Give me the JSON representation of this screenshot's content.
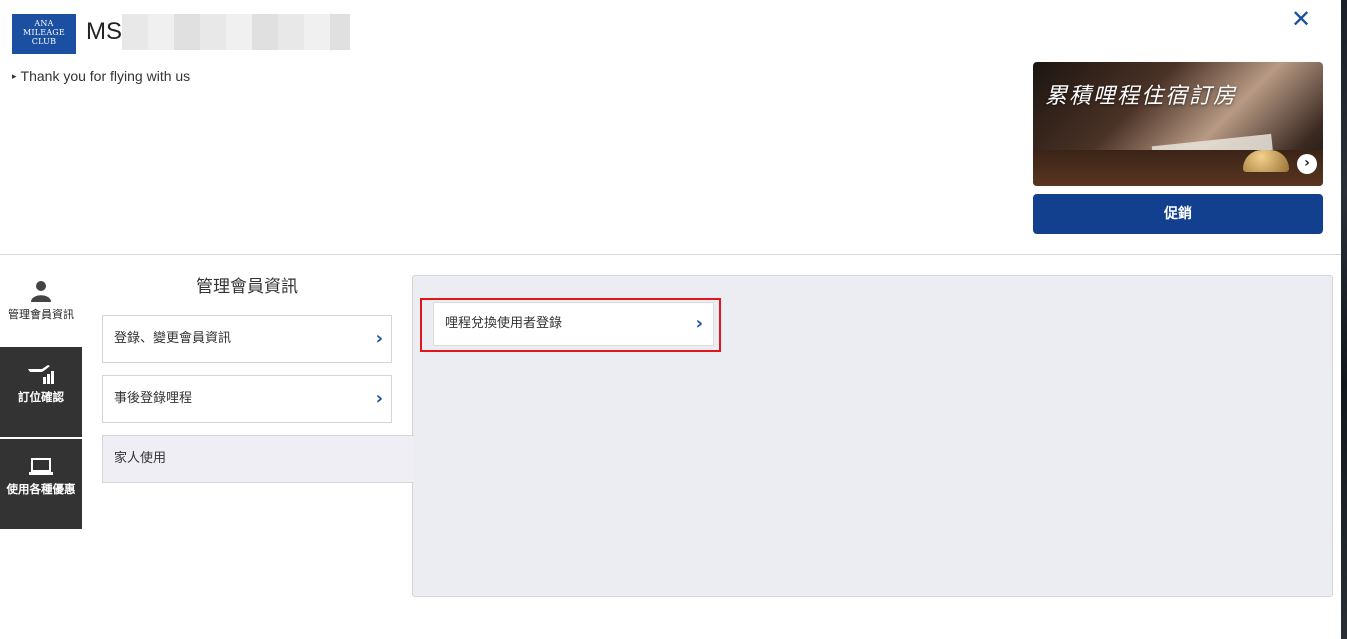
{
  "header": {
    "logo_lines": [
      "ANA",
      "MILEAGE",
      "CLUB"
    ],
    "member_name": "MS",
    "tagline": "Thank you for flying with us",
    "close_icon": "close-icon"
  },
  "promo": {
    "banner_title": "累積哩程住宿訂房",
    "arrow_icon": "chevron-right-circle-icon",
    "button_label": "促銷"
  },
  "side_tabs": [
    {
      "label": "管理會員資訊",
      "icon": "person-icon",
      "active": true
    },
    {
      "label": "訂位確認",
      "icon": "plane-chart-icon",
      "active": false
    },
    {
      "label": "使用各種優惠",
      "icon": "laptop-icon",
      "active": false
    }
  ],
  "section": {
    "heading": "管理會員資訊",
    "items": [
      {
        "label": "登錄、變更會員資訊",
        "chevron": "›"
      },
      {
        "label": "事後登錄哩程",
        "chevron": "›"
      },
      {
        "label": "家人使用",
        "selected": true
      }
    ]
  },
  "content": {
    "items": [
      {
        "label": "哩程兌換使用者登錄",
        "chevron": "›",
        "highlighted": true
      }
    ]
  },
  "colors": {
    "brand_blue": "#1a4fa2",
    "button_blue": "#12408f",
    "highlight_red": "#e0161b",
    "dark_tab": "#333333",
    "panel_bg": "#ececf3"
  }
}
